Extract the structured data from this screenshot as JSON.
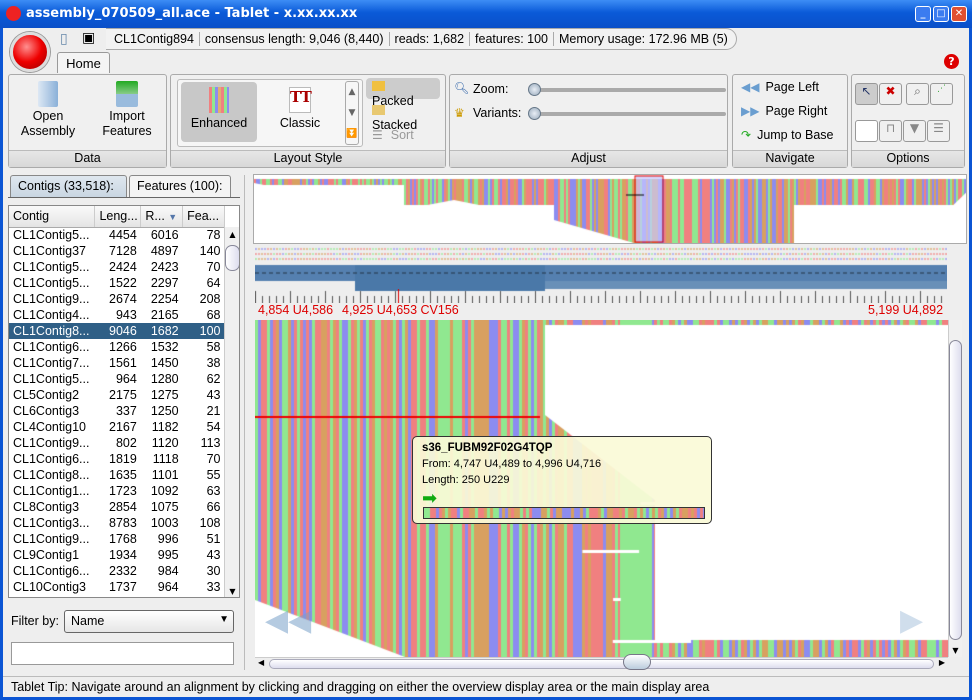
{
  "window": {
    "title": "assembly_070509_all.ace - Tablet - x.xx.xx.xx"
  },
  "status": {
    "contig": "CL1Contig894",
    "consensus": "consensus length: 9,046 (8,440)",
    "reads": "reads: 1,682",
    "features": "features: 100",
    "memory": "Memory usage: 172.96 MB (5)"
  },
  "ribbon": {
    "tab": "Home",
    "data": {
      "label": "Data",
      "open": "Open\nAssembly",
      "import": "Import\nFeatures"
    },
    "layout": {
      "label": "Layout Style",
      "enhanced": "Enhanced",
      "classic": "Classic",
      "packed": "Packed",
      "stacked": "Stacked",
      "sort": "Sort"
    },
    "adjust": {
      "label": "Adjust",
      "zoom": "Zoom:",
      "variants": "Variants:",
      "zoom_value": 0,
      "variants_value": 0
    },
    "navigate": {
      "label": "Navigate",
      "page_left": "Page Left",
      "page_right": "Page Right",
      "jump": "Jump to Base"
    },
    "options": {
      "label": "Options"
    }
  },
  "panel": {
    "tabs": [
      "Contigs (33,518):",
      "Features (100):"
    ],
    "columns": [
      "Contig",
      "Leng...",
      "R...",
      "Fea..."
    ],
    "rows": [
      [
        "CL1Contig5...",
        "4454",
        "6016",
        "78"
      ],
      [
        "CL1Contig37",
        "7128",
        "4897",
        "140"
      ],
      [
        "CL1Contig5...",
        "2424",
        "2423",
        "70"
      ],
      [
        "CL1Contig5...",
        "1522",
        "2297",
        "64"
      ],
      [
        "CL1Contig9...",
        "2674",
        "2254",
        "208"
      ],
      [
        "CL1Contig4...",
        "943",
        "2165",
        "68"
      ],
      [
        "CL1Contig8...",
        "9046",
        "1682",
        "100"
      ],
      [
        "CL1Contig6...",
        "1266",
        "1532",
        "58"
      ],
      [
        "CL1Contig7...",
        "1561",
        "1450",
        "38"
      ],
      [
        "CL1Contig5...",
        "964",
        "1280",
        "62"
      ],
      [
        "CL5Contig2",
        "2175",
        "1275",
        "43"
      ],
      [
        "CL6Contig3",
        "337",
        "1250",
        "21"
      ],
      [
        "CL4Contig10",
        "2167",
        "1182",
        "54"
      ],
      [
        "CL1Contig9...",
        "802",
        "1120",
        "113"
      ],
      [
        "CL1Contig6...",
        "1819",
        "1118",
        "70"
      ],
      [
        "CL1Contig8...",
        "1635",
        "1101",
        "55"
      ],
      [
        "CL1Contig1...",
        "1723",
        "1092",
        "63"
      ],
      [
        "CL8Contig3",
        "2854",
        "1075",
        "66"
      ],
      [
        "CL1Contig3...",
        "8783",
        "1003",
        "108"
      ],
      [
        "CL1Contig9...",
        "1768",
        "996",
        "51"
      ],
      [
        "CL9Contig1",
        "1934",
        "995",
        "43"
      ],
      [
        "CL1Contig6...",
        "2332",
        "984",
        "30"
      ],
      [
        "CL10Contig3",
        "1737",
        "964",
        "33"
      ]
    ],
    "selected_row": 6,
    "filter_label": "Filter by:",
    "filter_value": "Name",
    "filter_text": ""
  },
  "ruler": {
    "left": "4,854 U4,586",
    "mark": "4,925 U4,653 CV156",
    "right": "5,199 U4,892"
  },
  "tooltip": {
    "name": "s36_FUBM92F02G4TQP",
    "from": "From: 4,747 U4,489 to 4,996 U4,716",
    "length": "Length: 250 U229"
  },
  "colors": {
    "A": "#f08080",
    "C": "#90e890",
    "G": "#8c8cf0",
    "T": "#d8a060",
    "select": "#2f5f86",
    "ruler": "#dd0000"
  },
  "statusbar": "Tablet Tip: Navigate around an alignment by clicking and dragging on either the overview display area or the main display area"
}
